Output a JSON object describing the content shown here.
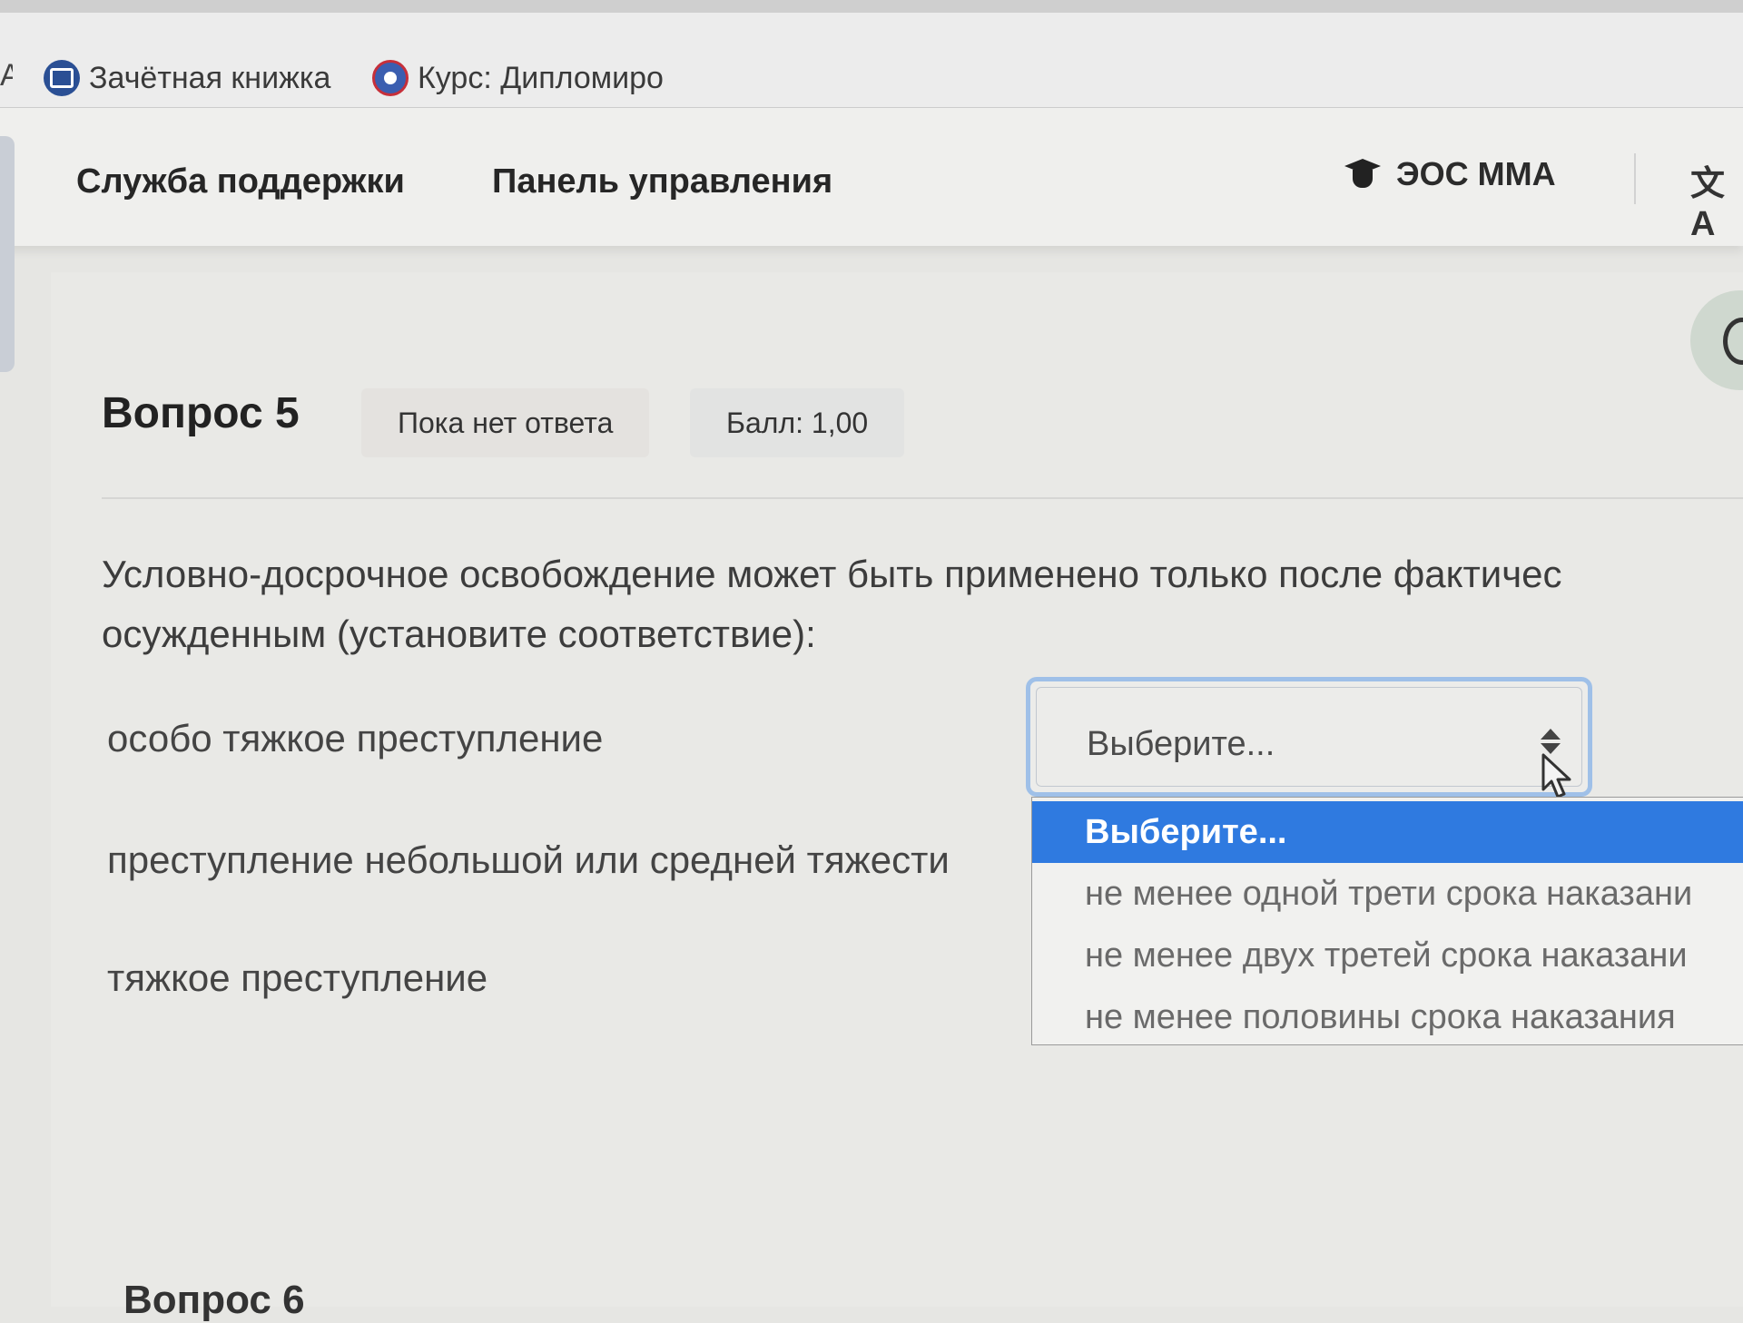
{
  "bookmarks": {
    "edge_fragment": "A",
    "items": [
      {
        "label": "Зачётная книжка",
        "icon": "record-book-icon"
      },
      {
        "label": "Курс: Дипломиро",
        "icon": "course-icon"
      }
    ]
  },
  "navbar": {
    "support": "Служба поддержки",
    "dashboard": "Панель управления",
    "site": "ЭОС ММА",
    "site_icon": "graduation-cap-icon",
    "translate_glyph": "文A"
  },
  "question": {
    "title": "Вопрос 5",
    "status": "Пока нет ответа",
    "score": "Балл: 1,00",
    "text_line1": "Условно-досрочное освобождение может быть применено только после фактичес",
    "text_line2": "осужденным (установите соответствие):",
    "rows": [
      {
        "label": "особо тяжкое преступление"
      },
      {
        "label": "преступление небольшой или средней тяжести"
      },
      {
        "label": "тяжкое преступление"
      }
    ],
    "select_value": "Выберите...",
    "options": [
      "Выберите...",
      "не менее одной трети срока наказани",
      "не менее двух третей срока наказани",
      "не менее половины срока наказания"
    ]
  },
  "next_question": "Вопрос 6",
  "colors": {
    "accent": "#2f7ae0",
    "focus_ring": "#9fc0e8"
  }
}
